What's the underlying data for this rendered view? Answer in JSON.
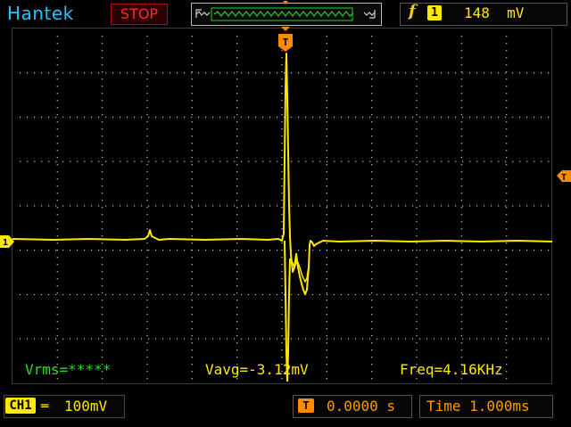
{
  "header": {
    "brand": "Hantek",
    "run_state": "STOP",
    "trigger": {
      "slope_symbol": "f",
      "source_badge": "1",
      "level": "148",
      "level_unit": "mV"
    }
  },
  "markers": {
    "ch1_ground": "1",
    "trigger_time": "T",
    "trigger_level": "T"
  },
  "measurements": {
    "vrms": "Vrms=*****",
    "vavg": "Vavg=-3.12mV",
    "freq": "Freq=4.16KHz"
  },
  "footer": {
    "channel_label": "CH1",
    "coupling_symbol": "═",
    "volts_per_div": "100mV",
    "time_offset_icon": "T",
    "time_offset": "0.0000 s",
    "time_per_div": "Time 1.000ms"
  },
  "colors": {
    "trace": "#ffe800",
    "brand": "#22c4ff",
    "stop": "#ff2a2a",
    "trigger": "#ff9a00",
    "measure": "#22e022",
    "grid": "#c8c8c8"
  }
}
